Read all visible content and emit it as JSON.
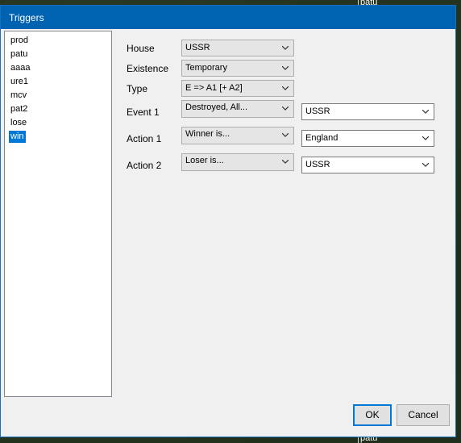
{
  "window": {
    "title": "Triggers"
  },
  "background": {
    "label_top": "patu",
    "label_bottom": "patu"
  },
  "trigger_list": {
    "items": [
      "prod",
      "patu",
      "aaaa",
      "ure1",
      "mcv",
      "pat2",
      "lose",
      "win"
    ],
    "selected": "win"
  },
  "form": {
    "house": {
      "label": "House",
      "value": "USSR"
    },
    "existence": {
      "label": "Existence",
      "value": "Temporary"
    },
    "type": {
      "label": "Type",
      "value": "E => A1 [+ A2]"
    },
    "event1": {
      "label": "Event 1",
      "value": "Destroyed, All...",
      "param": "USSR"
    },
    "action1": {
      "label": "Action 1",
      "value": "Winner is...",
      "param": "England"
    },
    "action2": {
      "label": "Action 2",
      "value": "Loser is...",
      "param": "USSR"
    }
  },
  "buttons": {
    "ok": "OK",
    "cancel": "Cancel"
  },
  "colors": {
    "titlebar": "#0063b1",
    "selection": "#0078d7",
    "dialog": "#f0f0f0"
  },
  "icons": {
    "dropdown": "chevron-down-icon"
  }
}
